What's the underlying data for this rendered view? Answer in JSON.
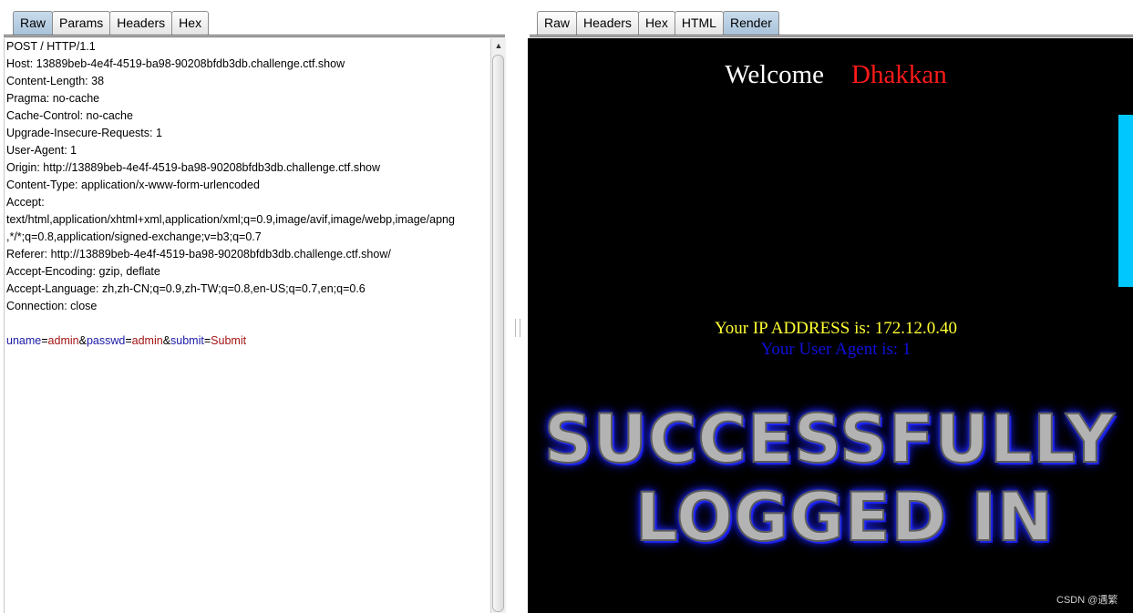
{
  "request": {
    "tabs": [
      "Raw",
      "Params",
      "Headers",
      "Hex"
    ],
    "active_tab": "Raw",
    "lines": [
      "POST / HTTP/1.1",
      "Host: 13889beb-4e4f-4519-ba98-90208bfdb3db.challenge.ctf.show",
      "Content-Length: 38",
      "Pragma: no-cache",
      "Cache-Control: no-cache",
      "Upgrade-Insecure-Requests: 1",
      "User-Agent: 1",
      "Origin: http://13889beb-4e4f-4519-ba98-90208bfdb3db.challenge.ctf.show",
      "Content-Type: application/x-www-form-urlencoded",
      "Accept:",
      "text/html,application/xhtml+xml,application/xml;q=0.9,image/avif,image/webp,image/apng",
      ",*/*;q=0.8,application/signed-exchange;v=b3;q=0.7",
      "Referer: http://13889beb-4e4f-4519-ba98-90208bfdb3db.challenge.ctf.show/",
      "Accept-Encoding: gzip, deflate",
      "Accept-Language: zh,zh-CN;q=0.9,zh-TW;q=0.8,en-US;q=0.7,en;q=0.6",
      "Connection: close",
      ""
    ],
    "body_params": [
      {
        "key": "uname",
        "value": "admin"
      },
      {
        "key": "passwd",
        "value": "admin"
      },
      {
        "key": "submit",
        "value": "Submit"
      }
    ],
    "eq": "=",
    "amp": "&",
    "scroll_up_glyph": "▲"
  },
  "response": {
    "tabs": [
      "Raw",
      "Headers",
      "Hex",
      "HTML",
      "Render"
    ],
    "active_tab": "Render",
    "welcome": "Welcome",
    "name": "Dhakkan",
    "ip_text": "Your IP ADDRESS is: 172.12.0.40",
    "ua_text": "Your User Agent is: 1",
    "banner_line1": "SUCCESSFULLY",
    "banner_line2": "LOGGED IN",
    "colors": {
      "name": "#ff1a1a",
      "ip": "#ffff33",
      "ua": "#1010dd",
      "accent_bar": "#00c8ff"
    }
  },
  "watermark": "CSDN @遇繁"
}
